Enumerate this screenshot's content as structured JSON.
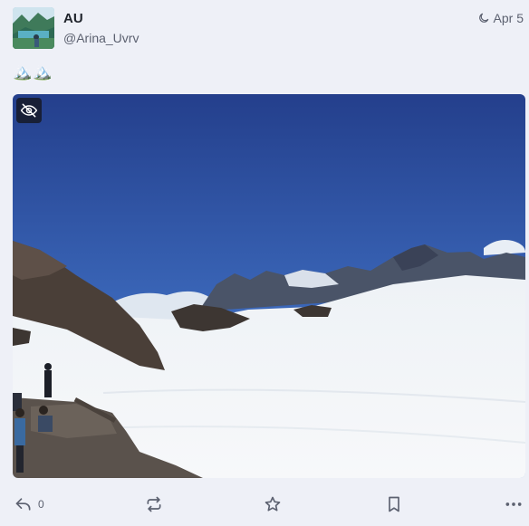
{
  "status": {
    "author": {
      "display_name": "AU",
      "handle": "@Arina_Uvrv",
      "avatar_icon": "avatar-landscape-image"
    },
    "date": "Apr 5",
    "visibility_icon": "moon-icon",
    "content": "🏔️🏔️",
    "media": {
      "description_icon": "eye-slash-icon",
      "kind": "photo of snowy mountain glacier"
    },
    "actions": {
      "reply_count": "0",
      "reply_icon": "reply-icon",
      "boost_icon": "boost-icon",
      "favourite_icon": "star-icon",
      "bookmark_icon": "bookmark-icon",
      "more_icon": "more-dots-icon"
    }
  },
  "colors": {
    "background": "#eef0f7",
    "text": "#1f232b",
    "muted": "#5c6170"
  }
}
